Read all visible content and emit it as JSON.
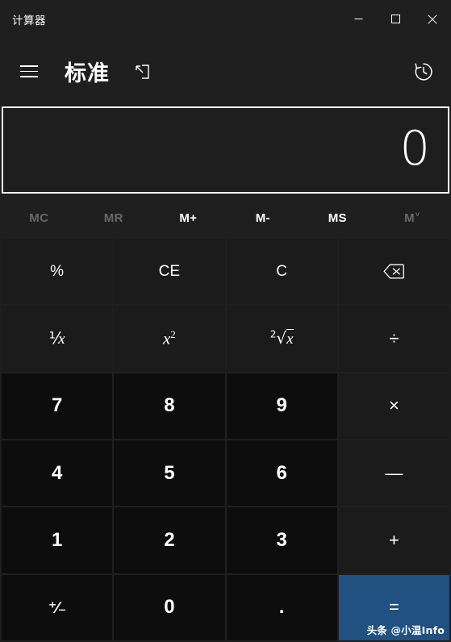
{
  "window": {
    "title": "计算器",
    "controls": {
      "minimize": "minimize-icon",
      "maximize": "maximize-icon",
      "close": "close-icon"
    }
  },
  "header": {
    "menu_icon": "hamburger-menu-icon",
    "mode_title": "标准",
    "keep_on_top_icon": "keep-on-top-icon",
    "history_icon": "history-clock-icon"
  },
  "display": {
    "value": "0",
    "expression": ""
  },
  "memory": {
    "buttons": [
      {
        "label": "MC",
        "name": "memory-clear",
        "enabled": false
      },
      {
        "label": "MR",
        "name": "memory-recall",
        "enabled": false
      },
      {
        "label": "M+",
        "name": "memory-add",
        "enabled": true
      },
      {
        "label": "M-",
        "name": "memory-subtract",
        "enabled": true
      },
      {
        "label": "MS",
        "name": "memory-store",
        "enabled": true
      },
      {
        "label": "M",
        "name": "memory-dropdown",
        "enabled": false,
        "chevron": "˅"
      }
    ]
  },
  "keypad": {
    "rows": [
      [
        {
          "label": "%",
          "name": "percent-button",
          "type": "fn"
        },
        {
          "label": "CE",
          "name": "clear-entry-button",
          "type": "fn"
        },
        {
          "label": "C",
          "name": "clear-button",
          "type": "fn"
        },
        {
          "label": "",
          "name": "backspace-button",
          "type": "fn",
          "icon": "backspace-icon"
        }
      ],
      [
        {
          "label": "1/x",
          "name": "reciprocal-button",
          "type": "fn",
          "glyph": "reciprocal"
        },
        {
          "label": "x2",
          "name": "square-button",
          "type": "fn",
          "glyph": "square"
        },
        {
          "label": "2√x",
          "name": "square-root-button",
          "type": "fn",
          "glyph": "sqrt"
        },
        {
          "label": "÷",
          "name": "divide-button",
          "type": "op"
        }
      ],
      [
        {
          "label": "7",
          "name": "digit-7-button",
          "type": "num"
        },
        {
          "label": "8",
          "name": "digit-8-button",
          "type": "num"
        },
        {
          "label": "9",
          "name": "digit-9-button",
          "type": "num"
        },
        {
          "label": "×",
          "name": "multiply-button",
          "type": "op"
        }
      ],
      [
        {
          "label": "4",
          "name": "digit-4-button",
          "type": "num"
        },
        {
          "label": "5",
          "name": "digit-5-button",
          "type": "num"
        },
        {
          "label": "6",
          "name": "digit-6-button",
          "type": "num"
        },
        {
          "label": "—",
          "name": "subtract-button",
          "type": "op"
        }
      ],
      [
        {
          "label": "1",
          "name": "digit-1-button",
          "type": "num"
        },
        {
          "label": "2",
          "name": "digit-2-button",
          "type": "num"
        },
        {
          "label": "3",
          "name": "digit-3-button",
          "type": "num"
        },
        {
          "label": "+",
          "name": "add-button",
          "type": "op"
        }
      ],
      [
        {
          "label": "+/-",
          "name": "sign-toggle-button",
          "type": "num",
          "glyph": "plusminus"
        },
        {
          "label": "0",
          "name": "digit-0-button",
          "type": "num"
        },
        {
          "label": ".",
          "name": "decimal-point-button",
          "type": "num"
        },
        {
          "label": "=",
          "name": "equals-button",
          "type": "eq"
        }
      ]
    ]
  },
  "watermark": {
    "text": "头条 @小温Info"
  },
  "colors": {
    "window_bg": "#1f1f1f",
    "fn_key": "#1b1b1b",
    "num_key": "#0d0d0d",
    "accent_equals": "#205180",
    "text": "#ffffff",
    "text_disabled": "#686868",
    "display_border": "#ffffff"
  }
}
